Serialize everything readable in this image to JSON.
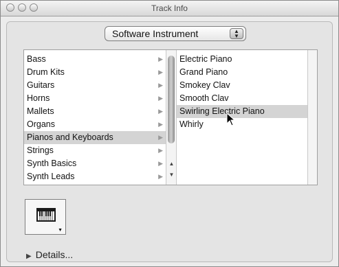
{
  "window": {
    "title": "Track Info"
  },
  "instrument_type": {
    "selected": "Software Instrument"
  },
  "categories": [
    {
      "label": "Bass"
    },
    {
      "label": "Drum Kits"
    },
    {
      "label": "Guitars"
    },
    {
      "label": "Horns"
    },
    {
      "label": "Mallets"
    },
    {
      "label": "Organs"
    },
    {
      "label": "Pianos and Keyboards",
      "selected": true
    },
    {
      "label": "Strings"
    },
    {
      "label": "Synth Basics"
    },
    {
      "label": "Synth Leads"
    }
  ],
  "instruments": [
    {
      "label": "Electric Piano"
    },
    {
      "label": "Grand Piano"
    },
    {
      "label": "Smokey Clav"
    },
    {
      "label": "Smooth Clav"
    },
    {
      "label": "Swirling Electric Piano",
      "selected": true
    },
    {
      "label": "Whirly"
    }
  ],
  "details": {
    "label": "Details..."
  },
  "icons": {
    "category_arrow": "triangle-right-icon",
    "instrument_icon": "keyboard-icon",
    "details_toggle": "disclosure-triangle-icon"
  }
}
